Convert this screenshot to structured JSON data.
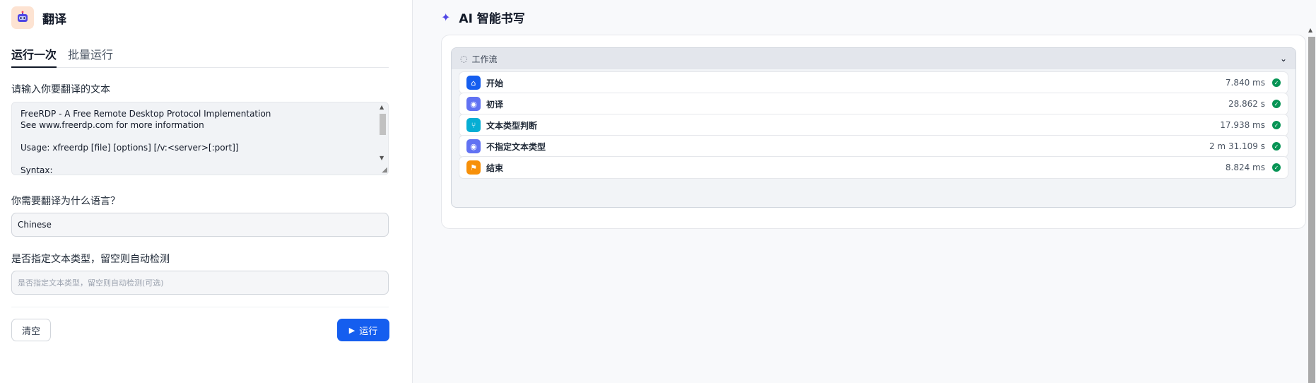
{
  "app": {
    "title": "翻译"
  },
  "tabs": [
    {
      "label": "运行一次",
      "active": true
    },
    {
      "label": "批量运行",
      "active": false
    }
  ],
  "form": {
    "text_label": "请输入你要翻译的文本",
    "text_value": "FreeRDP - A Free Remote Desktop Protocol Implementation\nSee www.freerdp.com for more information\n\nUsage: xfreerdp [file] [options] [/v:<server>[:port]]\n\nSyntax:",
    "language_label": "你需要翻译为什么语言？",
    "language_value": "Chinese",
    "type_label": "是否指定文本类型，留空则自动检测",
    "type_placeholder": "是否指定文本类型，留空则自动检测(可选)",
    "clear_label": "清空",
    "run_label": "运行"
  },
  "result": {
    "title": "AI 智能书写",
    "workflow_label": "工作流",
    "nodes": [
      {
        "name": "开始",
        "time": "7.840 ms",
        "icon": "home-icon",
        "color": "#155eef"
      },
      {
        "name": "初译",
        "time": "28.862 s",
        "icon": "brain-icon",
        "color": "#6172f3"
      },
      {
        "name": "文本类型判断",
        "time": "17.938 ms",
        "icon": "branch-icon",
        "color": "#06aed4"
      },
      {
        "name": "不指定文本类型",
        "time": "2 m 31.109 s",
        "icon": "brain-icon",
        "color": "#6172f3"
      },
      {
        "name": "结束",
        "time": "8.824 ms",
        "icon": "end-icon",
        "color": "#f79009"
      }
    ]
  }
}
